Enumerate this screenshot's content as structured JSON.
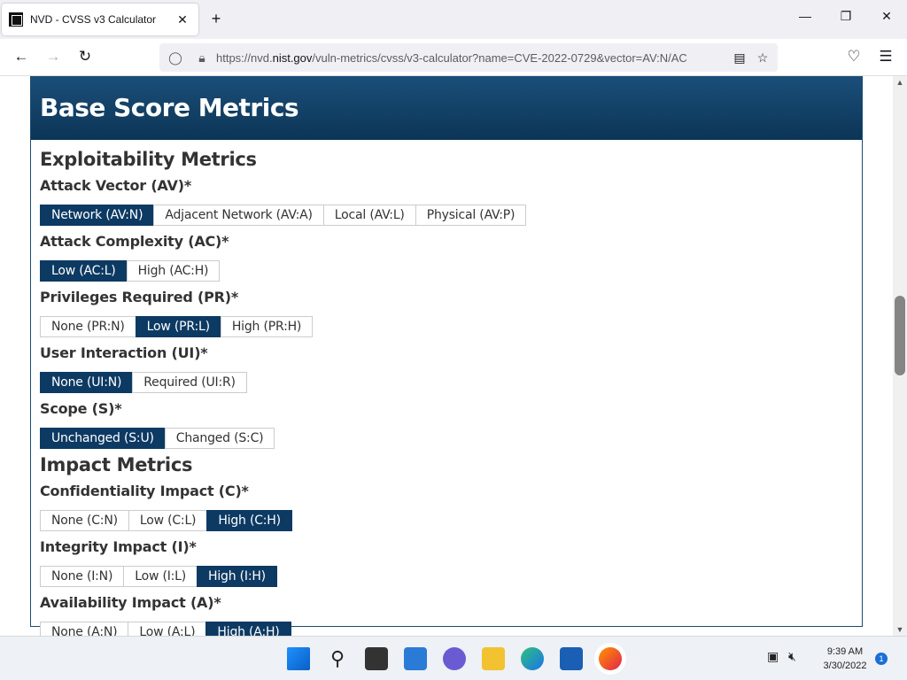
{
  "browser": {
    "tab_title": "NVD - CVSS v3 Calculator",
    "tab_close": "✕",
    "new_tab": "+",
    "url_prefix": "https://nvd.",
    "url_domain": "nist.gov",
    "url_suffix": "/vuln-metrics/cvss/v3-calculator?name=CVE-2022-0729&vector=AV:N/AC"
  },
  "panel": {
    "title": "Base Score Metrics",
    "exploitability_title": "Exploitability Metrics",
    "impact_title": "Impact Metrics",
    "metrics": {
      "av": {
        "label": "Attack Vector (AV)*",
        "options": [
          "Network (AV:N)",
          "Adjacent Network (AV:A)",
          "Local (AV:L)",
          "Physical (AV:P)"
        ],
        "selected": 0
      },
      "ac": {
        "label": "Attack Complexity (AC)*",
        "options": [
          "Low (AC:L)",
          "High (AC:H)"
        ],
        "selected": 0
      },
      "pr": {
        "label": "Privileges Required (PR)*",
        "options": [
          "None (PR:N)",
          "Low (PR:L)",
          "High (PR:H)"
        ],
        "selected": 1
      },
      "ui": {
        "label": "User Interaction (UI)*",
        "options": [
          "None (UI:N)",
          "Required (UI:R)"
        ],
        "selected": 0
      },
      "s": {
        "label": "Scope (S)*",
        "options": [
          "Unchanged (S:U)",
          "Changed (S:C)"
        ],
        "selected": 0
      },
      "c": {
        "label": "Confidentiality Impact (C)*",
        "options": [
          "None (C:N)",
          "Low (C:L)",
          "High (C:H)"
        ],
        "selected": 2
      },
      "i": {
        "label": "Integrity Impact (I)*",
        "options": [
          "None (I:N)",
          "Low (I:L)",
          "High (I:H)"
        ],
        "selected": 2
      },
      "a": {
        "label": "Availability Impact (A)*",
        "options": [
          "None (A:N)",
          "Low (A:L)",
          "High (A:H)"
        ],
        "selected": 2
      }
    }
  },
  "taskbar": {
    "time": "9:39 AM",
    "date": "3/30/2022",
    "notification_count": "1"
  },
  "colors": {
    "selected_bg": "#0d3a63",
    "header_bg": "#0c3556"
  }
}
